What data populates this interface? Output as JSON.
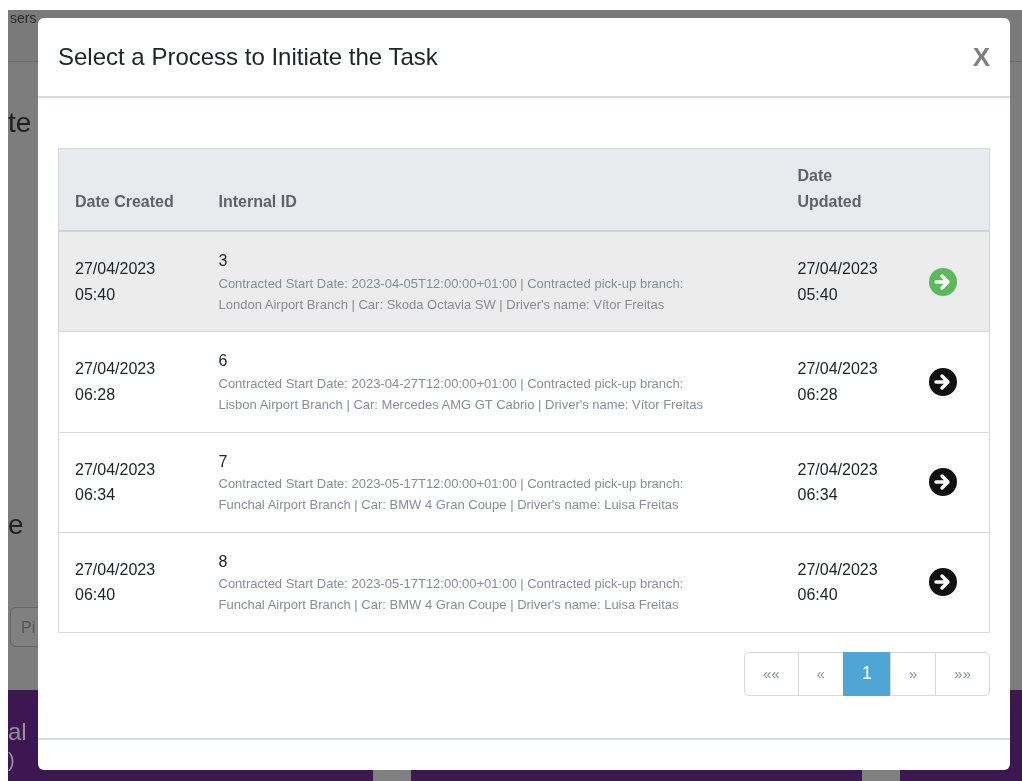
{
  "background": {
    "nav_items": [
      "sers"
    ],
    "headings": [
      "te",
      "e"
    ],
    "field": {
      "placeholder": "Pi"
    },
    "footer_texts": [
      "al",
      ")"
    ]
  },
  "modal": {
    "title": "Select a Process to Initiate the Task",
    "close": "X",
    "table": {
      "columns": [
        "Date Created",
        "Internal ID",
        "Date Updated"
      ],
      "rows": [
        {
          "date_created": "27/04/2023 05:40",
          "internal_id": "3",
          "details": "Contracted Start Date: 2023-04-05T12:00:00+01:00 | Contracted pick-up branch: London Airport Branch | Car: Skoda Octavia SW | Driver's name: Vítor Freitas",
          "date_updated": "27/04/2023 05:40",
          "selected": true
        },
        {
          "date_created": "27/04/2023 06:28",
          "internal_id": "6",
          "details": "Contracted Start Date: 2023-04-27T12:00:00+01:00 | Contracted pick-up branch: Lisbon Airport Branch | Car: Mercedes AMG GT Cabrio | Driver's name: Vítor Freitas",
          "date_updated": "27/04/2023 06:28",
          "selected": false
        },
        {
          "date_created": "27/04/2023 06:34",
          "internal_id": "7",
          "details": "Contracted Start Date: 2023-05-17T12:00:00+01:00 | Contracted pick-up branch: Funchal Airport Branch | Car: BMW 4 Gran Coupe | Driver's name: Luisa Freitas",
          "date_updated": "27/04/2023 06:34",
          "selected": false
        },
        {
          "date_created": "27/04/2023 06:40",
          "internal_id": "8",
          "details": "Contracted Start Date: 2023-05-17T12:00:00+01:00 | Contracted pick-up branch: Funchal Airport Branch | Car: BMW 4 Gran Coupe | Driver's name: Luisa Freitas",
          "date_updated": "27/04/2023 06:40",
          "selected": false
        }
      ]
    },
    "pagination": [
      {
        "label": "««",
        "selected": false
      },
      {
        "label": "«",
        "selected": false
      },
      {
        "label": "1",
        "selected": true
      },
      {
        "label": "»",
        "selected": false
      },
      {
        "label": "»»",
        "selected": false
      }
    ]
  }
}
